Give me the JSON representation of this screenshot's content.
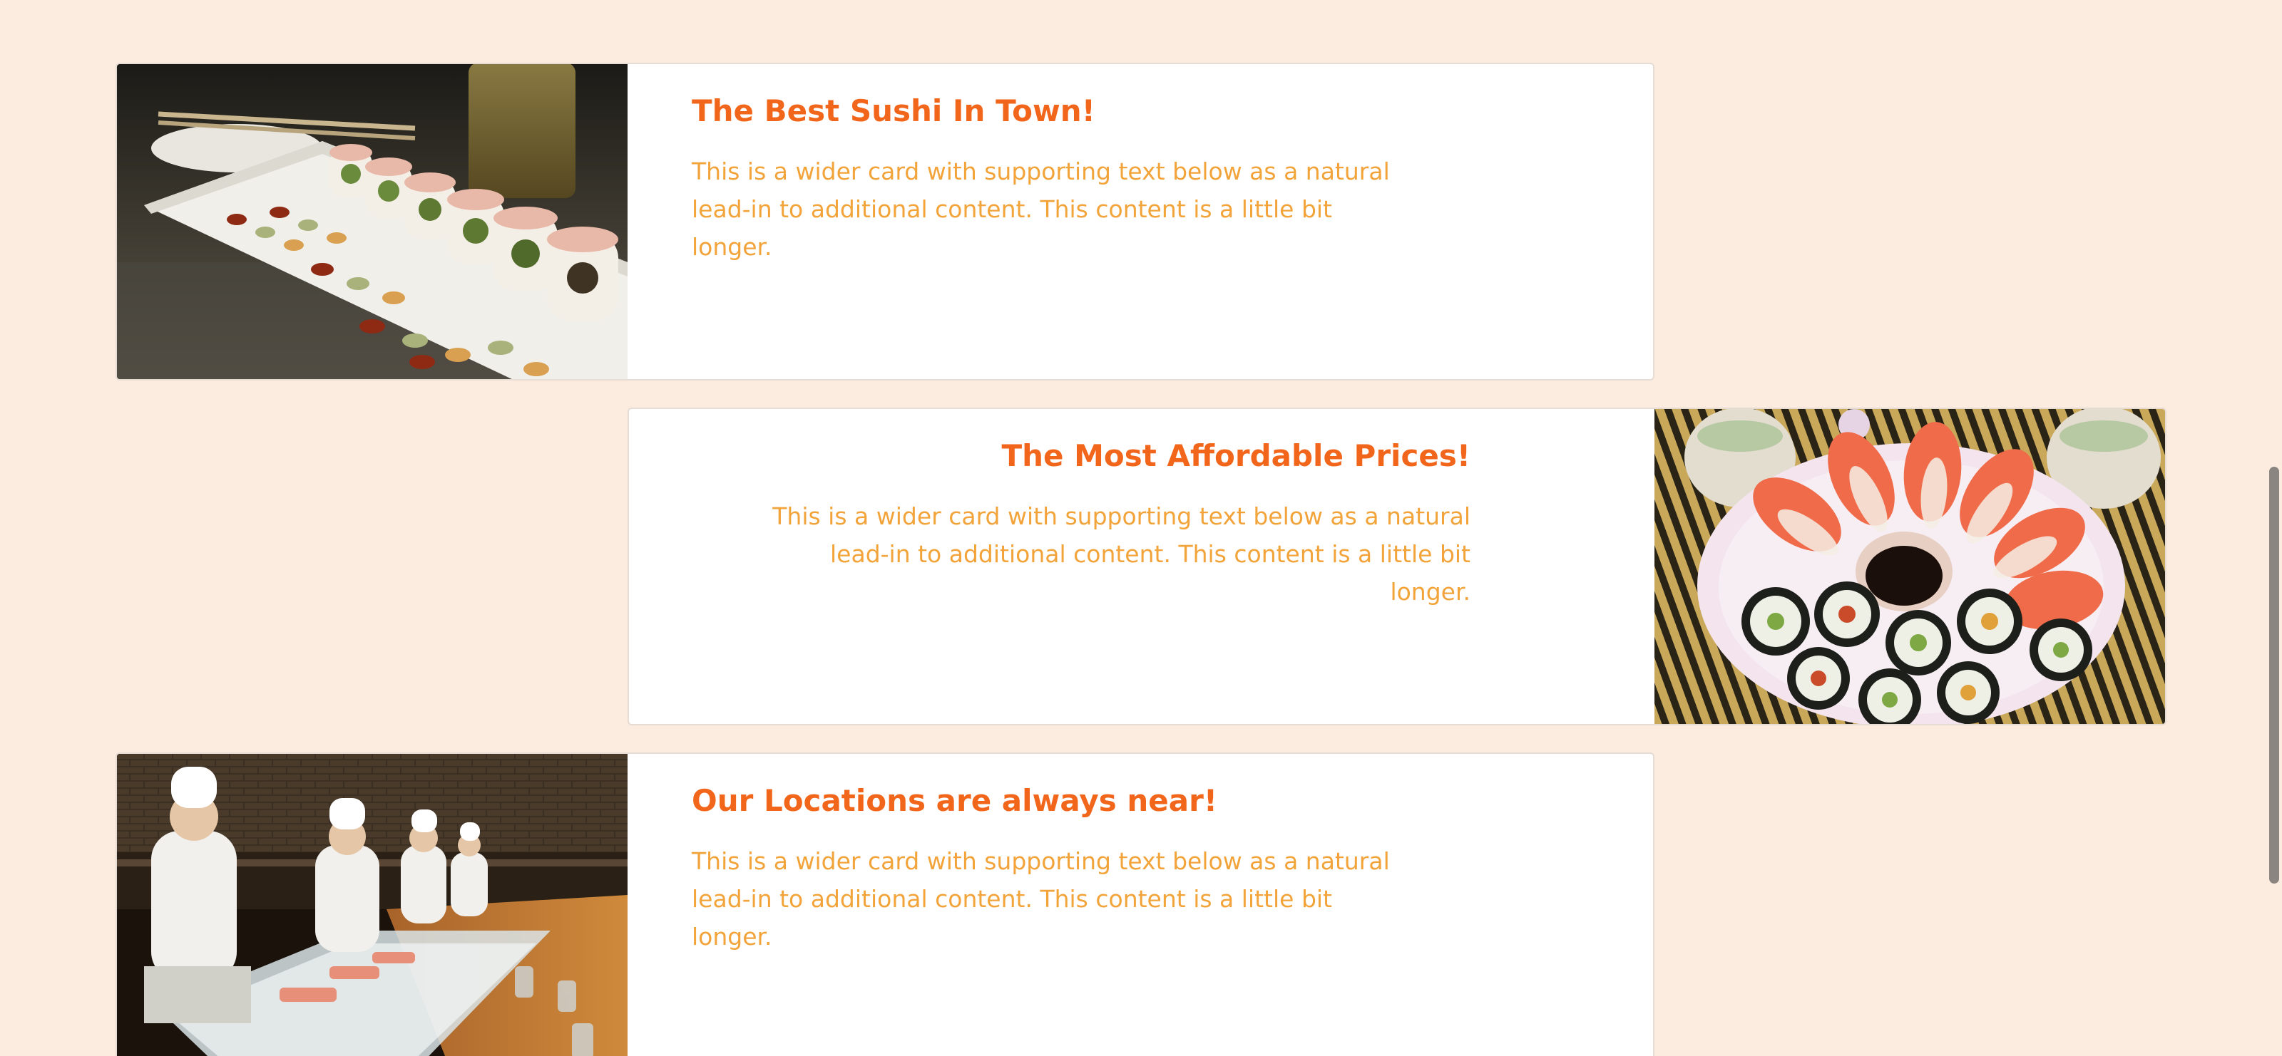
{
  "cards": [
    {
      "title": "The Best Sushi In Town!",
      "text": "This is a wider card with supporting text below as a natural lead-in to additional content. This content is a little bit longer.",
      "image": "sushi-roll-platter-photo"
    },
    {
      "title": "The Most Affordable Prices!",
      "text": "This is a wider card with supporting text below as a natural lead-in to additional content. This content is a little bit longer.",
      "image": "nigiri-and-maki-plate-photo"
    },
    {
      "title": "Our Locations are always near!",
      "text": "This is a wider card with supporting text below as a natural lead-in to additional content. This content is a little bit longer.",
      "image": "sushi-chefs-counter-photo"
    }
  ],
  "colors": {
    "background": "#fcebdf",
    "title": "#f2661c",
    "text": "#f2a43a",
    "card": "#ffffff"
  }
}
